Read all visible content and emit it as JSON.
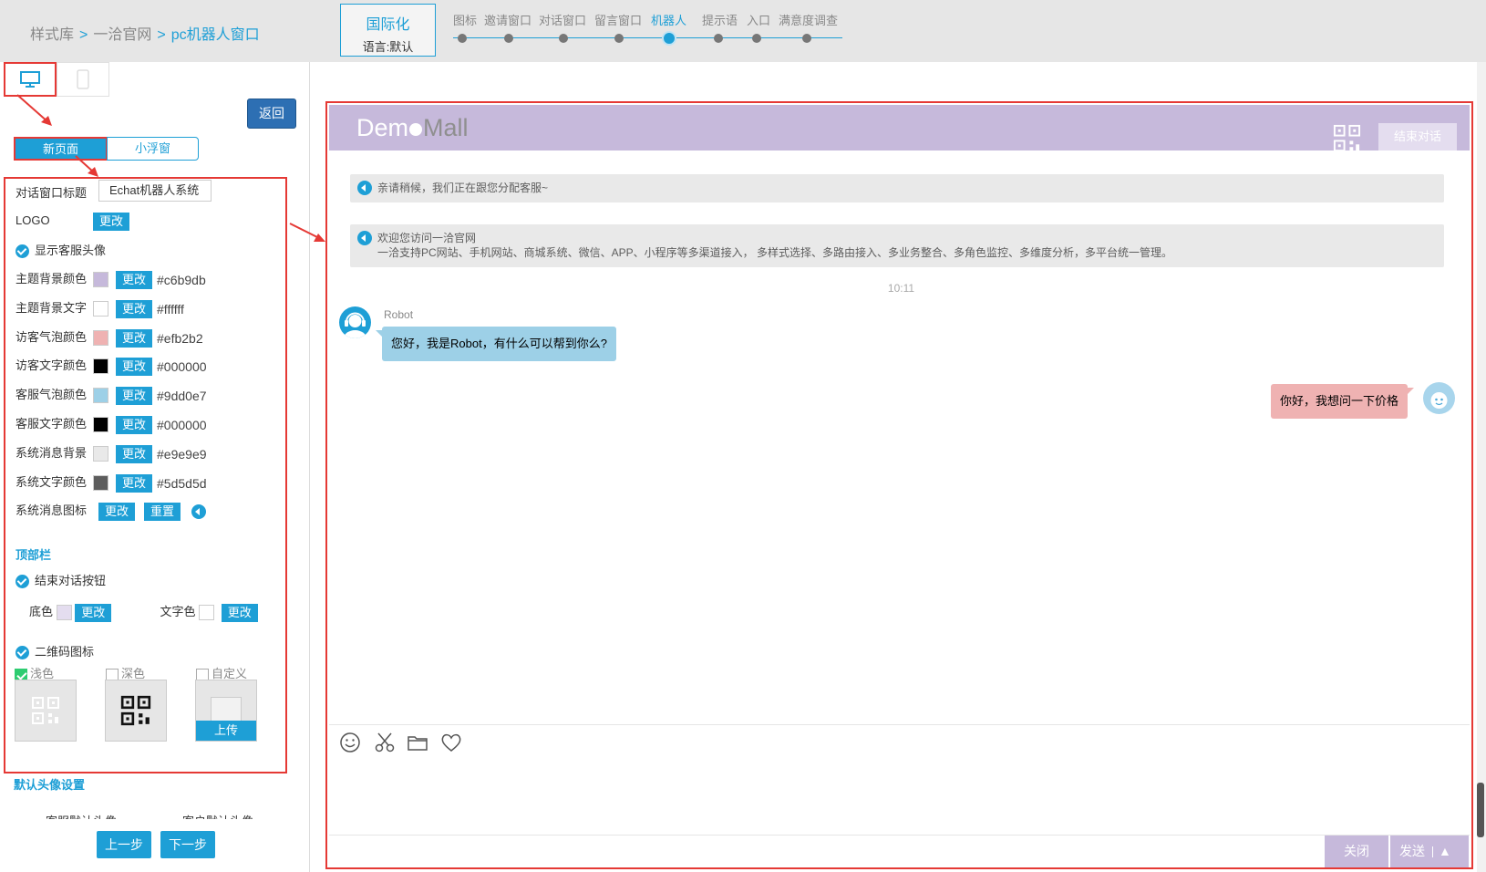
{
  "breadcrumb": {
    "items": [
      "样式库",
      "一洽官网",
      "pc机器人窗口"
    ],
    "separator": ">"
  },
  "i18n": {
    "title": "国际化",
    "language": "语言:默认"
  },
  "steps": [
    {
      "label": "图标",
      "active": false
    },
    {
      "label": "邀请窗口",
      "active": false
    },
    {
      "label": "对话窗口",
      "active": false
    },
    {
      "label": "留言窗口",
      "active": false
    },
    {
      "label": "机器人",
      "active": true
    },
    {
      "label": "提示语",
      "active": false
    },
    {
      "label": "入口",
      "active": false
    },
    {
      "label": "满意度调查",
      "active": false
    }
  ],
  "left": {
    "back_label": "返回",
    "mode_new": "新页面",
    "mode_float": "小浮窗",
    "title_label": "对话窗口标题",
    "title_value": "Echat机器人系统",
    "logo_label": "LOGO",
    "change_label": "更改",
    "reset_label": "重置",
    "show_avatar_label": "显示客服头像",
    "colors": [
      {
        "label": "主题背景颜色",
        "hex": "#c6b9db"
      },
      {
        "label": "主题背景文字",
        "hex": "#ffffff"
      },
      {
        "label": "访客气泡颜色",
        "hex": "#efb2b2"
      },
      {
        "label": "访客文字颜色",
        "hex": "#000000"
      },
      {
        "label": "客服气泡颜色",
        "hex": "#9dd0e7"
      },
      {
        "label": "客服文字颜色",
        "hex": "#000000"
      },
      {
        "label": "系统消息背景",
        "hex": "#e9e9e9"
      },
      {
        "label": "系统文字颜色",
        "hex": "#5d5d5d"
      }
    ],
    "sys_icon_label": "系统消息图标",
    "topbar_section": "顶部栏",
    "end_btn_label": "结束对话按钮",
    "bg_color_label": "底色",
    "text_color_label": "文字色",
    "end_bg": "#e4ddef",
    "end_text": "#ffffff",
    "qr_label": "二维码图标",
    "qr_options": [
      "浅色",
      "深色",
      "自定义"
    ],
    "upload_label": "上传",
    "avatar_section": "默认头像设置",
    "avatar_labels": [
      "客服默认头像",
      "客户默认头像"
    ],
    "prev_label": "上一步",
    "next_label": "下一步"
  },
  "preview": {
    "logo_demo": "Dem",
    "logo_mall": "Mall",
    "end_chat": "结束对话",
    "sys_msg_1": "亲请稍候，我们正在跟您分配客服~",
    "sys_msg_2_line1": "欢迎您访问一洽官网",
    "sys_msg_2_line2": "一洽支持PC网站、手机网站、商城系统、微信、APP、小程序等多渠道接入， 多样式选择、多路由接入、多业务整合、多角色监控、多维度分析，多平台统一管理。",
    "time": "10:11",
    "robot_name": "Robot",
    "robot_msg": "您好，我是Robot，有什么可以帮到你么?",
    "user_msg": "你好，我想问一下价格",
    "close_label": "关闭",
    "send_label": "发送",
    "send_arrow": "▲"
  },
  "colors": {
    "accent": "#1e9fd6",
    "theme_bg": "#c6b9db",
    "highlight_border": "#e53935"
  }
}
